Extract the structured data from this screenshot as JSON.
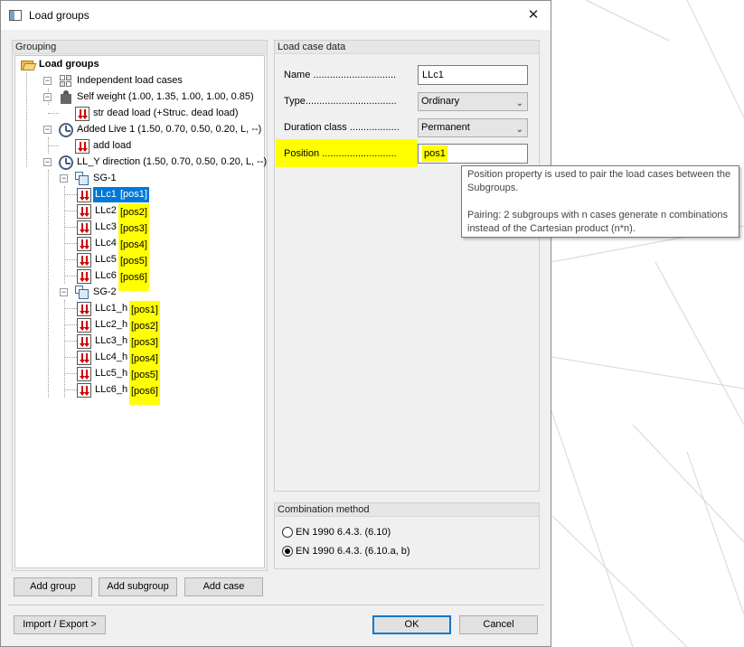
{
  "window": {
    "title": "Load groups",
    "close_glyph": "✕"
  },
  "grouping": {
    "header": "Grouping",
    "root_label": "Load groups",
    "nodes": [
      {
        "text": "Independent load cases",
        "icon": "independent-icon"
      },
      {
        "text": "Self weight  (1.00, 1.35, 1.00, 1.00, 0.85)",
        "icon": "weight-icon"
      },
      {
        "text": "str dead load  (+Struc. dead load)",
        "icon": "load-case-icon"
      },
      {
        "text": "Added Live 1  (1.50, 0.70, 0.50, 0.20, L, --)",
        "icon": "clock-icon"
      },
      {
        "text": "add load",
        "icon": "load-case-icon"
      },
      {
        "text": "LL_Y direction  (1.50, 0.70, 0.50, 0.20, L, --)",
        "icon": "clock-icon"
      },
      {
        "text": "SG-1",
        "icon": "subgroup-icon"
      },
      {
        "name": "LLc1",
        "pos": "[pos1]"
      },
      {
        "name": "LLc2",
        "pos": "[pos2]"
      },
      {
        "name": "LLc3",
        "pos": "[pos3]"
      },
      {
        "name": "LLc4",
        "pos": "[pos4]"
      },
      {
        "name": "LLc5",
        "pos": "[pos5]"
      },
      {
        "name": "LLc6",
        "pos": "[pos6]"
      },
      {
        "text": "SG-2",
        "icon": "subgroup-icon"
      },
      {
        "name": "LLc1_h",
        "pos": "[pos1]"
      },
      {
        "name": "LLc2_h",
        "pos": "[pos2]"
      },
      {
        "name": "LLc3_h",
        "pos": "[pos3]"
      },
      {
        "name": "LLc4_h",
        "pos": "[pos4]"
      },
      {
        "name": "LLc5_h",
        "pos": "[pos5]"
      },
      {
        "name": "LLc6_h",
        "pos": "[pos6]"
      }
    ],
    "selected": "LLc1",
    "buttons": {
      "add_group": "Add group",
      "add_subgroup": "Add subgroup",
      "add_case": "Add case"
    }
  },
  "load_case": {
    "header": "Load case data",
    "name_label": "Name ..............................",
    "name_value": "LLc1",
    "type_label": "Type.................................",
    "type_value": "Ordinary",
    "duration_label": "Duration class ..................",
    "duration_value": "Permanent",
    "position_label": "Position ...........................",
    "position_value": "pos1"
  },
  "tooltip": {
    "line1": "Position property is used to pair the load cases between the Subgroups.",
    "line2": "Pairing: 2 subgroups with n cases generate n combinations instead of the Cartesian product (n*n)."
  },
  "combination": {
    "header": "Combination method",
    "option1": "EN 1990 6.4.3. (6.10)",
    "option2": "EN 1990 6.4.3. (6.10.a, b)",
    "selected": "option2"
  },
  "footer": {
    "import_export": "Import / Export >",
    "ok": "OK",
    "cancel": "Cancel"
  },
  "colors": {
    "highlight": "#ffff00",
    "selection": "#0078d7",
    "load_arrow": "#d00000"
  }
}
